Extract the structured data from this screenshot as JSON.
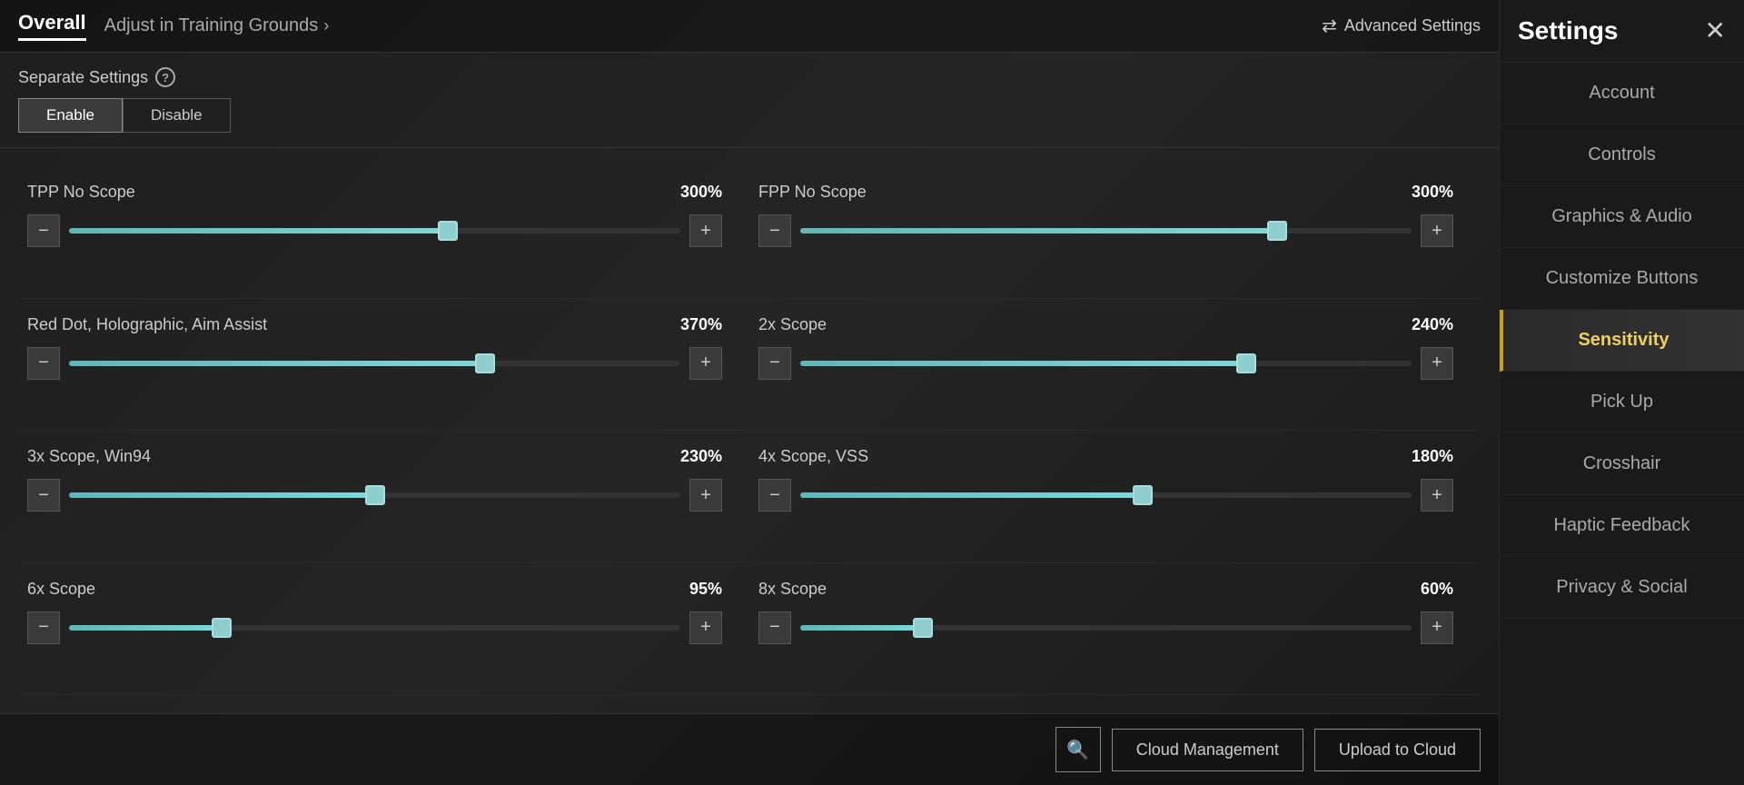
{
  "tabs": {
    "overall_label": "Overall",
    "training_label": "Adjust in Training Grounds",
    "advanced_label": "Advanced Settings"
  },
  "separate_settings": {
    "label": "Separate Settings",
    "enable_label": "Enable",
    "disable_label": "Disable",
    "active": "enable"
  },
  "sliders": [
    {
      "id": "tpp-no-scope",
      "label": "TPP No Scope",
      "value": "300%",
      "fill_pct": 62,
      "thumb_pct": 62
    },
    {
      "id": "fpp-no-scope",
      "label": "FPP No Scope",
      "value": "300%",
      "fill_pct": 78,
      "thumb_pct": 78
    },
    {
      "id": "red-dot",
      "label": "Red Dot, Holographic, Aim Assist",
      "value": "370%",
      "fill_pct": 68,
      "thumb_pct": 68
    },
    {
      "id": "2x-scope",
      "label": "2x Scope",
      "value": "240%",
      "fill_pct": 73,
      "thumb_pct": 73
    },
    {
      "id": "3x-scope",
      "label": "3x Scope, Win94",
      "value": "230%",
      "fill_pct": 50,
      "thumb_pct": 50
    },
    {
      "id": "4x-scope-vss",
      "label": "4x Scope, VSS",
      "value": "180%",
      "fill_pct": 56,
      "thumb_pct": 56
    },
    {
      "id": "6x-scope",
      "label": "6x Scope",
      "value": "95%",
      "fill_pct": 25,
      "thumb_pct": 25
    },
    {
      "id": "8x-scope",
      "label": "8x Scope",
      "value": "60%",
      "fill_pct": 20,
      "thumb_pct": 20
    }
  ],
  "bottom_bar": {
    "search_label": "🔍",
    "cloud_management_label": "Cloud Management",
    "upload_cloud_label": "Upload to Cloud"
  },
  "sidebar": {
    "title": "Settings",
    "close_label": "✕",
    "items": [
      {
        "id": "account",
        "label": "Account"
      },
      {
        "id": "controls",
        "label": "Controls"
      },
      {
        "id": "graphics-audio",
        "label": "Graphics & Audio"
      },
      {
        "id": "customize-buttons",
        "label": "Customize Buttons"
      },
      {
        "id": "sensitivity",
        "label": "Sensitivity",
        "active": true
      },
      {
        "id": "pick-up",
        "label": "Pick Up"
      },
      {
        "id": "crosshair",
        "label": "Crosshair"
      },
      {
        "id": "haptic-feedback",
        "label": "Haptic Feedback"
      },
      {
        "id": "privacy-social",
        "label": "Privacy & Social"
      }
    ]
  }
}
